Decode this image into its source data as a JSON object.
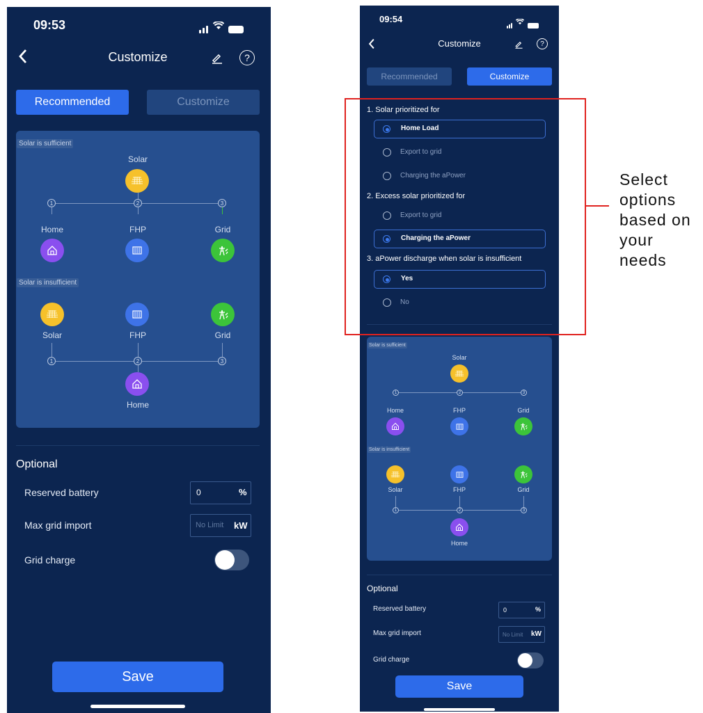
{
  "left_screen": {
    "status_time": "09:53",
    "header": {
      "title": "Customize",
      "back_icon": "chevron-left-icon",
      "edit_icon": "edit-icon",
      "help_icon": "help-icon"
    },
    "tabs": [
      {
        "label": "Recommended",
        "active": true
      },
      {
        "label": "Customize",
        "active": false
      }
    ],
    "diagram": {
      "sufficient_label": "Solar is sufficient",
      "insufficient_label": "Solar is insufficient",
      "solar": "Solar",
      "home": "Home",
      "fhp": "FHP",
      "grid": "Grid",
      "nums": [
        "1",
        "2",
        "3"
      ]
    },
    "optional": {
      "title": "Optional",
      "reserved_battery_label": "Reserved battery",
      "reserved_battery_value": "0",
      "reserved_battery_unit": "%",
      "max_grid_import_label": "Max grid import",
      "max_grid_import_placeholder": "No Limit",
      "max_grid_import_unit": "kW",
      "grid_charge_label": "Grid charge",
      "grid_charge_on": false
    },
    "save_label": "Save"
  },
  "right_screen": {
    "status_time": "09:54",
    "header": {
      "title": "Customize",
      "back_icon": "chevron-left-icon",
      "edit_icon": "edit-icon",
      "help_icon": "help-icon"
    },
    "tabs": [
      {
        "label": "Recommended",
        "active": false
      },
      {
        "label": "Customize",
        "active": true
      }
    ],
    "questions": [
      {
        "title": "1. Solar prioritized for",
        "options": [
          {
            "label": "Home Load",
            "selected": true
          },
          {
            "label": "Export to grid",
            "selected": false
          },
          {
            "label": "Charging the aPower",
            "selected": false
          }
        ]
      },
      {
        "title": "2. Excess solar prioritized for",
        "options": [
          {
            "label": "Export to grid",
            "selected": false
          },
          {
            "label": "Charging the aPower",
            "selected": true
          }
        ]
      },
      {
        "title": "3. aPower discharge when solar is insufficient",
        "options": [
          {
            "label": "Yes",
            "selected": true
          },
          {
            "label": "No",
            "selected": false
          }
        ]
      }
    ],
    "diagram": {
      "sufficient_label": "Solar is sufficient",
      "insufficient_label": "Solar is insufficient",
      "solar": "Solar",
      "home": "Home",
      "fhp": "FHP",
      "grid": "Grid",
      "nums": [
        "1",
        "2",
        "3"
      ]
    },
    "optional": {
      "title": "Optional",
      "reserved_battery_label": "Reserved battery",
      "reserved_battery_value": "0",
      "reserved_battery_unit": "%",
      "max_grid_import_label": "Max grid import",
      "max_grid_import_placeholder": "No Limit",
      "max_grid_import_unit": "kW",
      "grid_charge_label": "Grid charge",
      "grid_charge_on": false
    },
    "save_label": "Save"
  },
  "annotation": {
    "lines": [
      "Select",
      "options",
      "based on",
      "your",
      "needs"
    ],
    "highlight_color": "#e0221f"
  },
  "colors": {
    "background": "#0c2550",
    "accent": "#2d6bea",
    "solar": "#f6c12b",
    "fhp": "#3e73e8",
    "grid": "#3cc43a",
    "home": "#8a4fef"
  }
}
